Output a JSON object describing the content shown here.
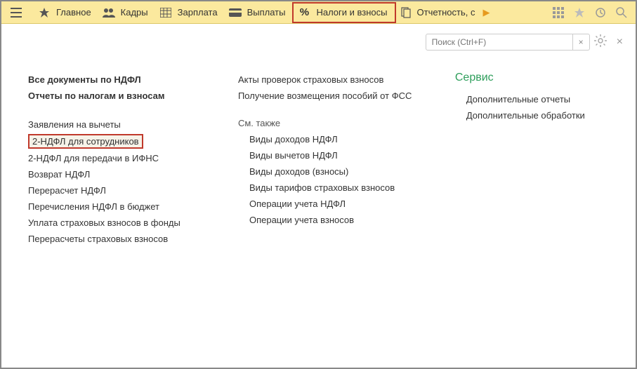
{
  "toolbar": {
    "items": [
      {
        "label": "Главное"
      },
      {
        "label": "Кадры"
      },
      {
        "label": "Зарплата"
      },
      {
        "label": "Выплаты"
      },
      {
        "label": "Налоги и взносы"
      },
      {
        "label": "Отчетность, с"
      }
    ]
  },
  "search": {
    "placeholder": "Поиск (Ctrl+F)"
  },
  "col1": {
    "header1": "Все документы по НДФЛ",
    "header2": "Отчеты по налогам и взносам",
    "items": [
      "Заявления на вычеты",
      "2-НДФЛ для сотрудников",
      "2-НДФЛ для передачи в ИФНС",
      "Возврат НДФЛ",
      "Перерасчет НДФЛ",
      "Перечисления НДФЛ в бюджет",
      "Уплата страховых взносов в фонды",
      "Перерасчеты страховых взносов"
    ]
  },
  "col2": {
    "top": [
      "Акты проверок страховых взносов",
      "Получение возмещения пособий от ФСС"
    ],
    "seealso_label": "См. также",
    "seealso": [
      "Виды доходов НДФЛ",
      "Виды вычетов НДФЛ",
      "Виды доходов (взносы)",
      "Виды тарифов страховых взносов",
      "Операции учета НДФЛ",
      "Операции учета взносов"
    ]
  },
  "col3": {
    "header": "Сервис",
    "items": [
      "Дополнительные отчеты",
      "Дополнительные обработки"
    ]
  }
}
